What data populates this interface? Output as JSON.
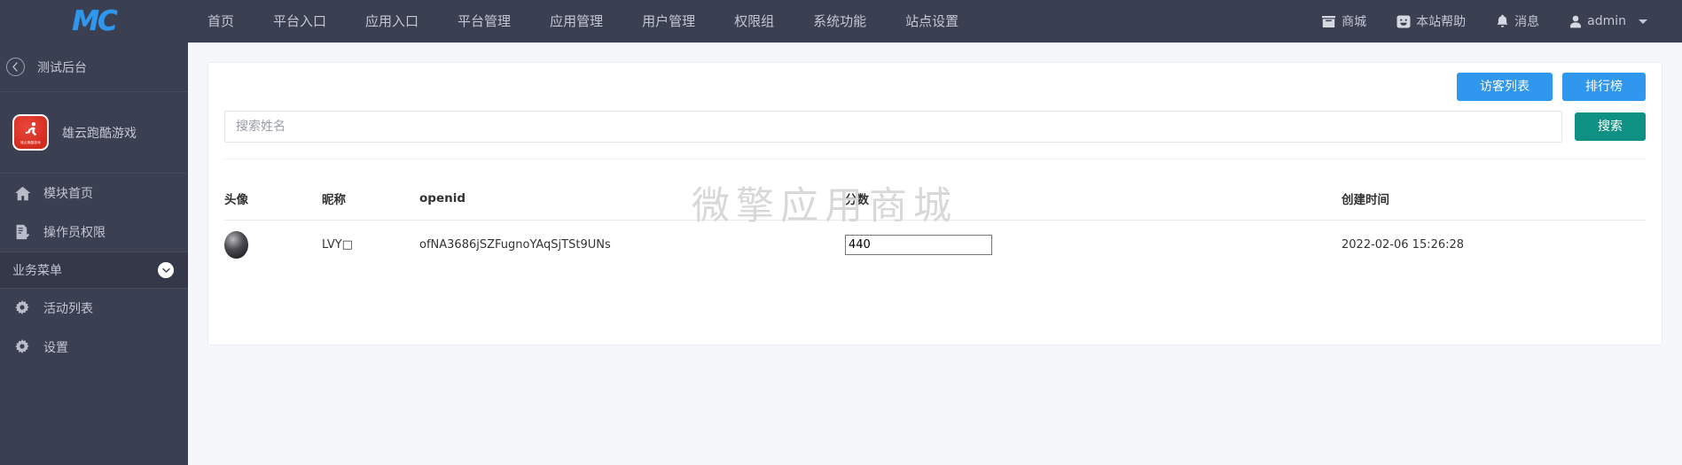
{
  "brand": {
    "logo_text": "MC"
  },
  "topnav": {
    "items": [
      {
        "label": "首页"
      },
      {
        "label": "平台入口"
      },
      {
        "label": "应用入口"
      },
      {
        "label": "平台管理"
      },
      {
        "label": "应用管理"
      },
      {
        "label": "用户管理"
      },
      {
        "label": "权限组"
      },
      {
        "label": "系统功能"
      },
      {
        "label": "站点设置"
      }
    ],
    "right_items": [
      {
        "icon": "store-icon",
        "label": "商城"
      },
      {
        "icon": "help-icon",
        "label": "本站帮助"
      },
      {
        "icon": "bell-icon",
        "label": "消息"
      },
      {
        "icon": "user-icon",
        "label": "admin"
      }
    ]
  },
  "sidebar": {
    "back_label": "测试后台",
    "app_name": "雄云跑酷游戏",
    "app_logo_caption": "雄云跑酷游戏",
    "links": [
      {
        "icon": "home-icon",
        "label": "模块首页"
      },
      {
        "icon": "permission-icon",
        "label": "操作员权限"
      }
    ],
    "group_label": "业务菜单",
    "group_links": [
      {
        "icon": "gear-icon",
        "label": "活动列表"
      },
      {
        "icon": "gear-icon",
        "label": "设置"
      }
    ]
  },
  "toolbar": {
    "visitor_list_label": "访客列表",
    "leaderboard_label": "排行榜"
  },
  "search": {
    "placeholder": "搜索姓名",
    "value": "",
    "button_label": "搜索"
  },
  "watermark": "微擎应用商城",
  "table": {
    "headers": [
      "头像",
      "昵称",
      "openid",
      "分数",
      "创建时间"
    ],
    "rows": [
      {
        "avatar": "user-avatar",
        "nickname": "LVY□",
        "openid": "ofNA3686jSZFugnoYAqSjTSt9UNs",
        "score": "440",
        "created_at": "2022-02-06 15:26:28"
      }
    ]
  },
  "colors": {
    "topbar_bg": "#3a3f51",
    "sidebar_bg": "#3a3f51",
    "accent_blue": "#2f97ee",
    "accent_teal": "#0e9183",
    "logo_red": "#d32b1e",
    "page_bg": "#f6f7fb"
  }
}
